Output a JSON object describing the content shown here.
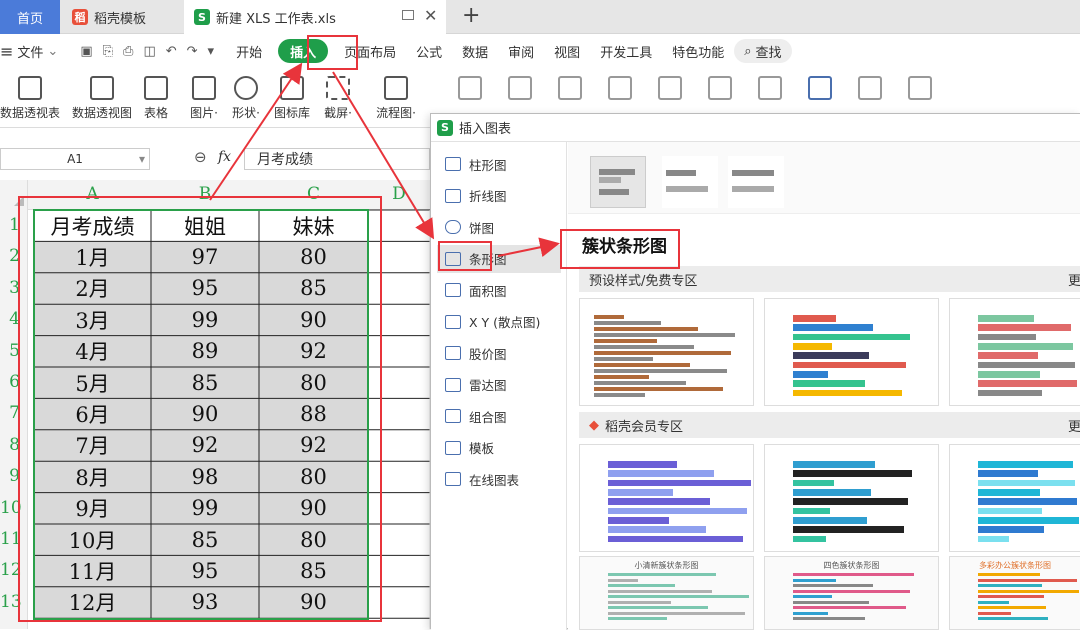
{
  "tabs": {
    "home": "首页",
    "template": "稻壳模板",
    "file": "新建 XLS 工作表.xls"
  },
  "menu": {
    "file": "文件",
    "items": [
      "开始",
      "插入",
      "页面布局",
      "公式",
      "数据",
      "审阅",
      "视图",
      "开发工具",
      "特色功能"
    ],
    "search": "查找"
  },
  "ribbon": {
    "items": [
      "数据透视表",
      "数据透视图",
      "表格",
      "图片·",
      "形状·",
      "图标库",
      "截屏·",
      "流程图·"
    ]
  },
  "formula_bar": {
    "cell_ref": "A1",
    "fx": "fx",
    "value": "月考成绩"
  },
  "sheet": {
    "columns": [
      "A",
      "B",
      "C",
      "D"
    ],
    "rows": [
      "1",
      "2",
      "3",
      "4",
      "5",
      "6",
      "7",
      "8",
      "9",
      "10",
      "11",
      "12",
      "13"
    ],
    "data": [
      [
        "月考成绩",
        "姐姐",
        "妹妹"
      ],
      [
        "1月",
        "97",
        "80"
      ],
      [
        "2月",
        "95",
        "85"
      ],
      [
        "3月",
        "99",
        "90"
      ],
      [
        "4月",
        "89",
        "92"
      ],
      [
        "5月",
        "85",
        "80"
      ],
      [
        "6月",
        "90",
        "88"
      ],
      [
        "7月",
        "92",
        "92"
      ],
      [
        "8月",
        "98",
        "80"
      ],
      [
        "9月",
        "99",
        "90"
      ],
      [
        "10月",
        "85",
        "80"
      ],
      [
        "11月",
        "95",
        "85"
      ],
      [
        "12月",
        "93",
        "90"
      ]
    ]
  },
  "dialog": {
    "title": "插入图表",
    "types": [
      "柱形图",
      "折线图",
      "饼图",
      "条形图",
      "面积图",
      "X Y (散点图)",
      "股价图",
      "雷达图",
      "组合图",
      "模板",
      "在线图表"
    ],
    "selected_type": "条形图",
    "subtype_title": "簇状条形图",
    "section_free": "预设样式/免费专区",
    "section_member": "稻壳会员专区",
    "more": "更",
    "thumb_titles": [
      "小清新簇状条形图",
      "四色簇状条形图",
      "多彩办公簇状条形图"
    ]
  },
  "colors": {
    "accent": "#1f9e4a",
    "annotation": "#e8343b",
    "home_tab": "#4b7bd9"
  }
}
